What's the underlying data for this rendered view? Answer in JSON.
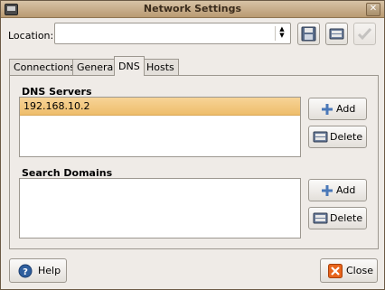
{
  "window": {
    "title": "Network Settings"
  },
  "location": {
    "label": "Location:",
    "value": ""
  },
  "tabs": [
    {
      "label": "Connections"
    },
    {
      "label": "General"
    },
    {
      "label": "DNS"
    },
    {
      "label": "Hosts"
    }
  ],
  "dns": {
    "servers_title": "DNS Servers",
    "servers": [
      "192.168.10.2"
    ],
    "domains_title": "Search Domains",
    "domains": [],
    "add_label": "Add",
    "delete_label": "Delete"
  },
  "footer": {
    "help_label": "Help",
    "close_label": "Close"
  },
  "colors": {
    "selection": "#eebd6b",
    "titlebar": "#b99a72",
    "close_icon": "#e8641b",
    "help_icon": "#2f5f9e"
  }
}
